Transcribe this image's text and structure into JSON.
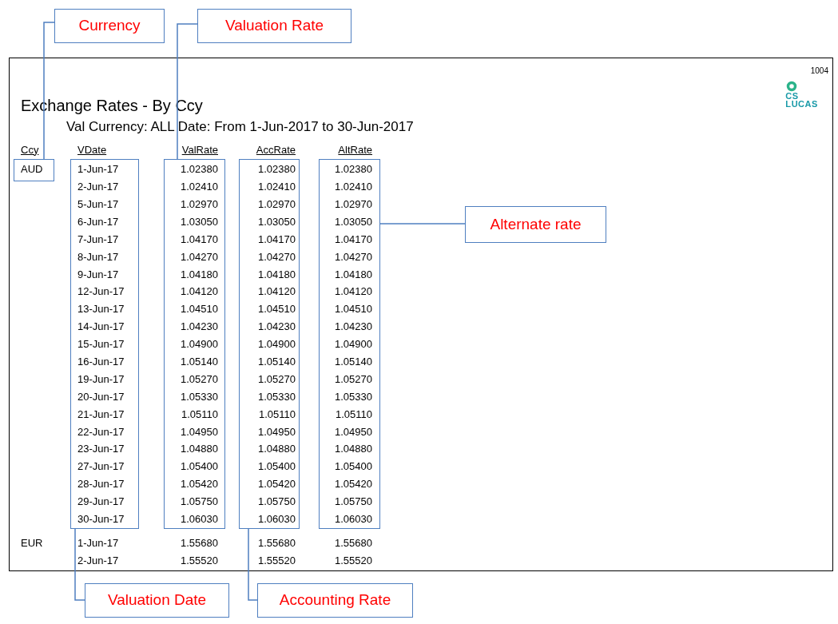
{
  "report": {
    "page_number": "1004",
    "logo": [
      "CS",
      "LUCAS"
    ],
    "title": "Exchange Rates - By Ccy",
    "subtitle": "Val Currency: ALL Date: From  1-Jun-2017 to  30-Jun-2017",
    "columns": [
      "Ccy",
      "VDate",
      "ValRate",
      "AccRate",
      "AltRate"
    ],
    "groups": [
      {
        "currency": "AUD",
        "rows": [
          [
            "1-Jun-17",
            "1.02380",
            "1.02380",
            "1.02380"
          ],
          [
            "2-Jun-17",
            "1.02410",
            "1.02410",
            "1.02410"
          ],
          [
            "5-Jun-17",
            "1.02970",
            "1.02970",
            "1.02970"
          ],
          [
            "6-Jun-17",
            "1.03050",
            "1.03050",
            "1.03050"
          ],
          [
            "7-Jun-17",
            "1.04170",
            "1.04170",
            "1.04170"
          ],
          [
            "8-Jun-17",
            "1.04270",
            "1.04270",
            "1.04270"
          ],
          [
            "9-Jun-17",
            "1.04180",
            "1.04180",
            "1.04180"
          ],
          [
            "12-Jun-17",
            "1.04120",
            "1.04120",
            "1.04120"
          ],
          [
            "13-Jun-17",
            "1.04510",
            "1.04510",
            "1.04510"
          ],
          [
            "14-Jun-17",
            "1.04230",
            "1.04230",
            "1.04230"
          ],
          [
            "15-Jun-17",
            "1.04900",
            "1.04900",
            "1.04900"
          ],
          [
            "16-Jun-17",
            "1.05140",
            "1.05140",
            "1.05140"
          ],
          [
            "19-Jun-17",
            "1.05270",
            "1.05270",
            "1.05270"
          ],
          [
            "20-Jun-17",
            "1.05330",
            "1.05330",
            "1.05330"
          ],
          [
            "21-Jun-17",
            "1.05110",
            "1.05110",
            "1.05110"
          ],
          [
            "22-Jun-17",
            "1.04950",
            "1.04950",
            "1.04950"
          ],
          [
            "23-Jun-17",
            "1.04880",
            "1.04880",
            "1.04880"
          ],
          [
            "27-Jun-17",
            "1.05400",
            "1.05400",
            "1.05400"
          ],
          [
            "28-Jun-17",
            "1.05420",
            "1.05420",
            "1.05420"
          ],
          [
            "29-Jun-17",
            "1.05750",
            "1.05750",
            "1.05750"
          ],
          [
            "30-Jun-17",
            "1.06030",
            "1.06030",
            "1.06030"
          ]
        ]
      },
      {
        "currency": "EUR",
        "rows": [
          [
            "1-Jun-17",
            "1.55680",
            "1.55680",
            "1.55680"
          ],
          [
            "2-Jun-17",
            "1.55520",
            "1.55520",
            "1.55520"
          ]
        ]
      }
    ]
  },
  "callouts": [
    {
      "label": "Currency"
    },
    {
      "label": "Valuation Rate"
    },
    {
      "label": "Alternate rate"
    },
    {
      "label": "Valuation Date"
    },
    {
      "label": "Accounting Rate"
    }
  ]
}
